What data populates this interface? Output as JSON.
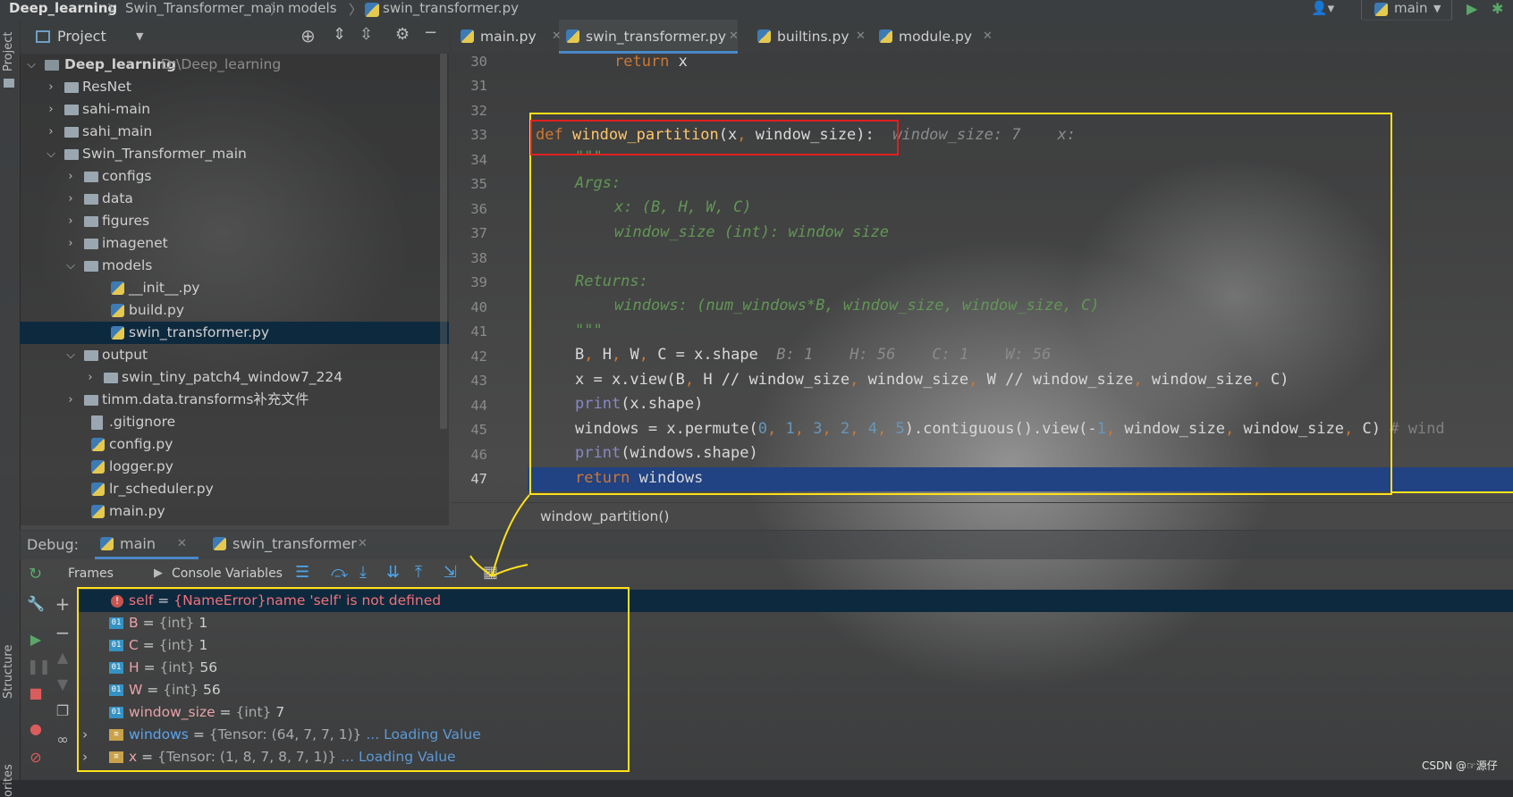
{
  "topbar": {
    "crumbs": [
      "Deep_learning",
      "Swin_Transformer_main",
      "models",
      "swin_transformer.py"
    ],
    "run_config": "main"
  },
  "sidebar": {
    "project_label": "Project",
    "structure_label": "Structure",
    "favorites_label": "orites"
  },
  "project": {
    "title": "Project",
    "root_name": "Deep_learning",
    "root_path": "D:\\Deep_learning",
    "items": [
      {
        "label": "ResNet"
      },
      {
        "label": "sahi-main"
      },
      {
        "label": "sahi_main"
      },
      {
        "label": "Swin_Transformer_main"
      },
      {
        "label": "configs"
      },
      {
        "label": "data"
      },
      {
        "label": "figures"
      },
      {
        "label": "imagenet"
      },
      {
        "label": "models"
      },
      {
        "label": "__init__.py"
      },
      {
        "label": "build.py"
      },
      {
        "label": "swin_transformer.py"
      },
      {
        "label": "output"
      },
      {
        "label": "swin_tiny_patch4_window7_224"
      },
      {
        "label": "timm.data.transforms补充文件"
      },
      {
        "label": ".gitignore"
      },
      {
        "label": "config.py"
      },
      {
        "label": "logger.py"
      },
      {
        "label": "lr_scheduler.py"
      },
      {
        "label": "main.py"
      }
    ]
  },
  "editor": {
    "tabs": [
      {
        "label": "main.py"
      },
      {
        "label": "swin_transformer.py"
      },
      {
        "label": "builtins.py"
      },
      {
        "label": "module.py"
      }
    ],
    "line_numbers": [
      "30",
      "31",
      "32",
      "33",
      "34",
      "35",
      "36",
      "37",
      "38",
      "39",
      "40",
      "41",
      "42",
      "43",
      "44",
      "45",
      "46",
      "47"
    ],
    "breadcrumb": "window_partition()",
    "hints": {
      "l33": "window_size: 7    x:",
      "l42": "B: 1    H: 56    C: 1    W: 56"
    }
  },
  "debug": {
    "label": "Debug:",
    "sessions": [
      {
        "label": "main"
      },
      {
        "label": "swin_transformer"
      }
    ],
    "toolbar": {
      "frames": "Frames",
      "console": "Console",
      "variables": "Variables"
    },
    "variables": [
      {
        "name": "self",
        "rest": " = ",
        "type": "{NameError}",
        "value": "name 'self' is not defined",
        "kind": "error"
      },
      {
        "name": "B",
        "rest": " = ",
        "type": "{int}",
        "value": " 1",
        "kind": "int"
      },
      {
        "name": "C",
        "rest": " = ",
        "type": "{int}",
        "value": " 1",
        "kind": "int"
      },
      {
        "name": "H",
        "rest": " = ",
        "type": "{int}",
        "value": " 56",
        "kind": "int"
      },
      {
        "name": "W",
        "rest": " = ",
        "type": "{int}",
        "value": " 56",
        "kind": "int"
      },
      {
        "name": "window_size",
        "rest": " = ",
        "type": "{int}",
        "value": " 7",
        "kind": "int"
      },
      {
        "name": "windows",
        "rest": " = ",
        "type": "{Tensor: (64, 7, 7, 1)}",
        "value": "... Loading Value",
        "kind": "tensor"
      },
      {
        "name": "x",
        "rest": " = ",
        "type": "{Tensor: (1, 8, 7, 8, 7, 1)}",
        "value": "... Loading Value",
        "kind": "tensor"
      }
    ]
  },
  "watermark": "CSDN @☞源仔",
  "colors": {
    "annotation_yellow": "#ffe11a",
    "annotation_red": "#e02020",
    "selection": "#0d293e",
    "current_line": "#214283"
  }
}
